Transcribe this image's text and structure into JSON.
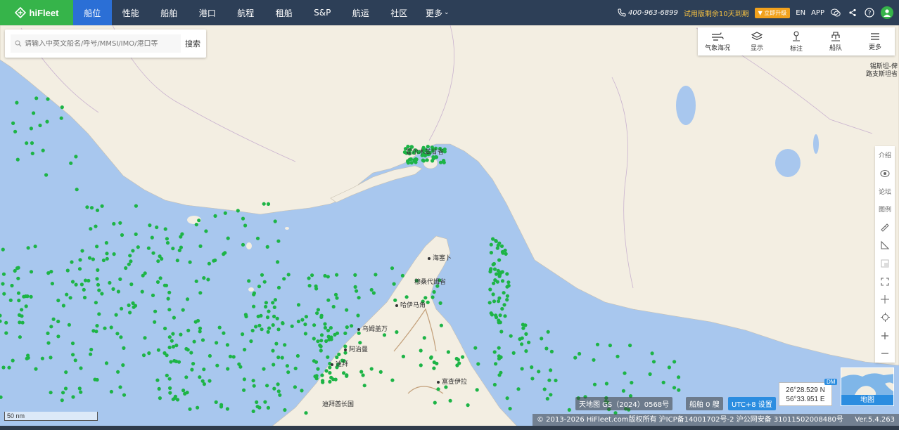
{
  "brand": {
    "name": "hiFleet",
    "color": "#36b44a"
  },
  "nav": {
    "items": [
      "船位",
      "性能",
      "船舶",
      "港口",
      "航程",
      "租船",
      "S&P",
      "航运",
      "社区",
      "更多"
    ],
    "active_index": 0
  },
  "topright": {
    "phone": "400-963-6899",
    "trial_text": "试用版剩余10天到期",
    "upgrade_label": "立即升级",
    "lang": "EN",
    "app": "APP"
  },
  "search": {
    "placeholder": "请输入中英文船名/呼号/MMSI/IMO/港口等",
    "button": "搜索"
  },
  "tools": [
    {
      "label": "气象海况",
      "icon": "weather-icon"
    },
    {
      "label": "显示",
      "icon": "layers-icon"
    },
    {
      "label": "标注",
      "icon": "pin-icon"
    },
    {
      "label": "船队",
      "icon": "fleet-icon"
    },
    {
      "label": "更多",
      "icon": "menu-icon"
    }
  ],
  "sidebar": {
    "items": [
      {
        "label": "介绍",
        "icon": ""
      },
      {
        "label": "",
        "icon": "camera-icon"
      },
      {
        "label": "论坛",
        "icon": ""
      },
      {
        "label": "图例",
        "icon": ""
      },
      {
        "label": "",
        "icon": "ruler-icon"
      },
      {
        "label": "",
        "icon": "angle-icon"
      },
      {
        "label": "",
        "icon": "area-icon"
      },
      {
        "label": "",
        "icon": "fullscreen-icon"
      },
      {
        "label": "",
        "icon": "crosshair-icon"
      },
      {
        "label": "",
        "icon": "locate-icon"
      },
      {
        "label": "",
        "icon": "zoom-in-icon"
      },
      {
        "label": "",
        "icon": "zoom-out-icon"
      }
    ]
  },
  "map": {
    "labels": [
      {
        "text": "霍尔木兹甘省",
        "kind": "province"
      },
      {
        "text": "海塞卜",
        "kind": "city"
      },
      {
        "text": "穆桑代姆省",
        "kind": "province"
      },
      {
        "text": "哈伊马角",
        "kind": "city"
      },
      {
        "text": "乌姆盖万",
        "kind": "city"
      },
      {
        "text": "阿治曼",
        "kind": "city"
      },
      {
        "text": "迪拜",
        "kind": "city"
      },
      {
        "text": "迪拜酋长国",
        "kind": "province"
      },
      {
        "text": "富查伊拉",
        "kind": "city"
      },
      {
        "text": "锡斯坦-俾路支斯坦省",
        "kind": "province"
      }
    ],
    "ship_color": "#1db446",
    "water_color": "#a8c7ee",
    "land_color": "#f3eee2"
  },
  "bottom": {
    "scale": "50 nm",
    "map_source": "天地图 GS（2024）0568号",
    "ship_count": "船舶 0 艘",
    "timezone": "UTC+8 设置",
    "coord_lat": "26°28.529 N",
    "coord_lon": "56°33.951 E",
    "coord_mode": "DM",
    "minimap_label": "地图",
    "copyright": "© 2013-2026 HiFleet.com版权所有 沪ICP备14001702号-2 沪公网安备 31011502008480号",
    "version": "Ver.5.4.263"
  }
}
